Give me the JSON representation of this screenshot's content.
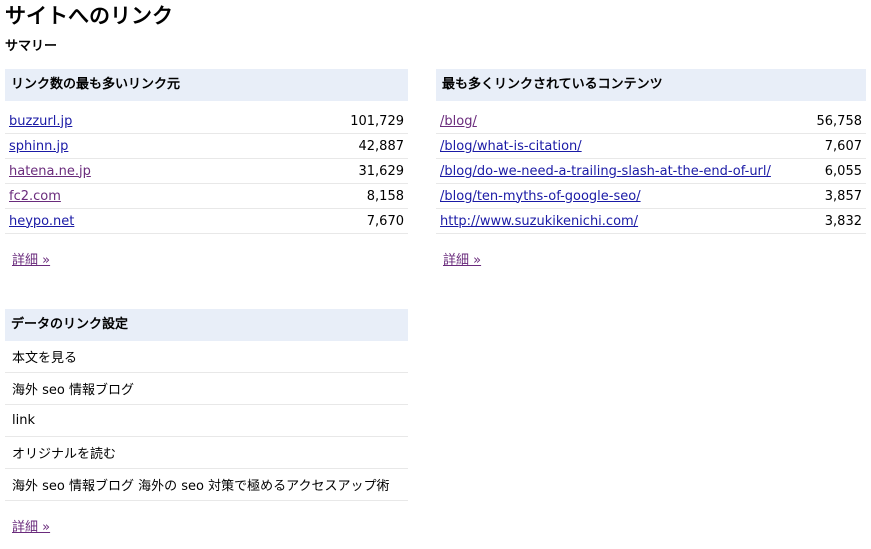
{
  "page": {
    "title": "サイトへのリンク",
    "summary_label": "サマリー"
  },
  "top_linking_sites": {
    "header": "リンク数の最も多いリンク元",
    "rows": [
      {
        "name": "buzzurl.jp",
        "count": "101,729",
        "visited": false
      },
      {
        "name": "sphinn.jp",
        "count": "42,887",
        "visited": false
      },
      {
        "name": "hatena.ne.jp",
        "count": "31,629",
        "visited": true
      },
      {
        "name": "fc2.com",
        "count": "8,158",
        "visited": true
      },
      {
        "name": "heypo.net",
        "count": "7,670",
        "visited": false
      }
    ],
    "more_label": "詳細 »"
  },
  "top_linked_content": {
    "header": "最も多くリンクされているコンテンツ",
    "rows": [
      {
        "name": "/blog/",
        "count": "56,758",
        "visited": true
      },
      {
        "name": "/blog/what-is-citation/",
        "count": "7,607",
        "visited": false
      },
      {
        "name": "/blog/do-we-need-a-trailing-slash-at-the-end-of-url/",
        "count": "6,055",
        "visited": false
      },
      {
        "name": "/blog/ten-myths-of-google-seo/",
        "count": "3,857",
        "visited": false
      },
      {
        "name": "http://www.suzukikenichi.com/",
        "count": "3,832",
        "visited": false
      }
    ],
    "more_label": "詳細 »"
  },
  "anchor_text": {
    "header": "データのリンク設定",
    "rows": [
      "本文を見る",
      "海外 seo 情報ブログ",
      "link",
      "オリジナルを読む",
      "海外 seo 情報ブログ 海外の seo 対策で極めるアクセスアップ術"
    ],
    "more_label": "詳細 »"
  },
  "colors": {
    "header_bg": "#e8eef8",
    "link": "#1a1aa6",
    "visited_link": "#6a2b7c",
    "row_border": "#e8e8e8"
  }
}
